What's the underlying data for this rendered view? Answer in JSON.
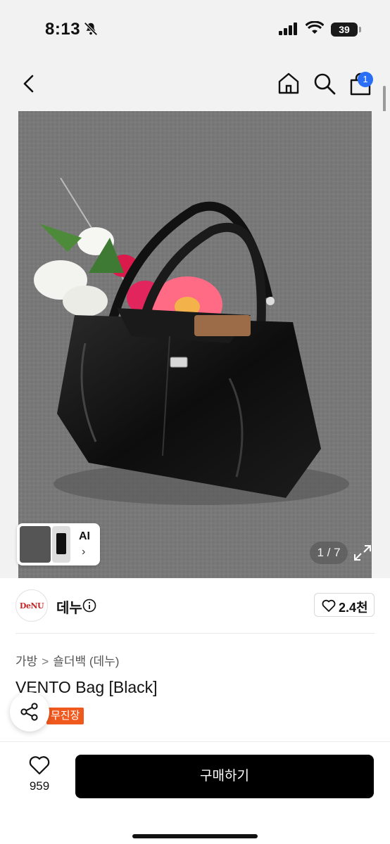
{
  "status_bar": {
    "time": "8:13",
    "battery": "39"
  },
  "nav": {
    "cart_count": "1"
  },
  "gallery": {
    "counter": "1 / 7",
    "ai_label": "AI",
    "ai_chevron": "›"
  },
  "seller": {
    "logo_text": "DeNU",
    "name": "데누",
    "likes": "2.4천"
  },
  "breadcrumb": {
    "category": "가방",
    "separator": ">",
    "subcategory": "숄더백 (데누)"
  },
  "product": {
    "title": "VENTO Bag [Black]",
    "badge": "무진장"
  },
  "bottom_bar": {
    "fav_count": "959",
    "buy_label": "구매하기"
  },
  "colors": {
    "accent_blue": "#2b6ef6",
    "badge_orange": "#f0591e",
    "buy_black": "#000000"
  }
}
